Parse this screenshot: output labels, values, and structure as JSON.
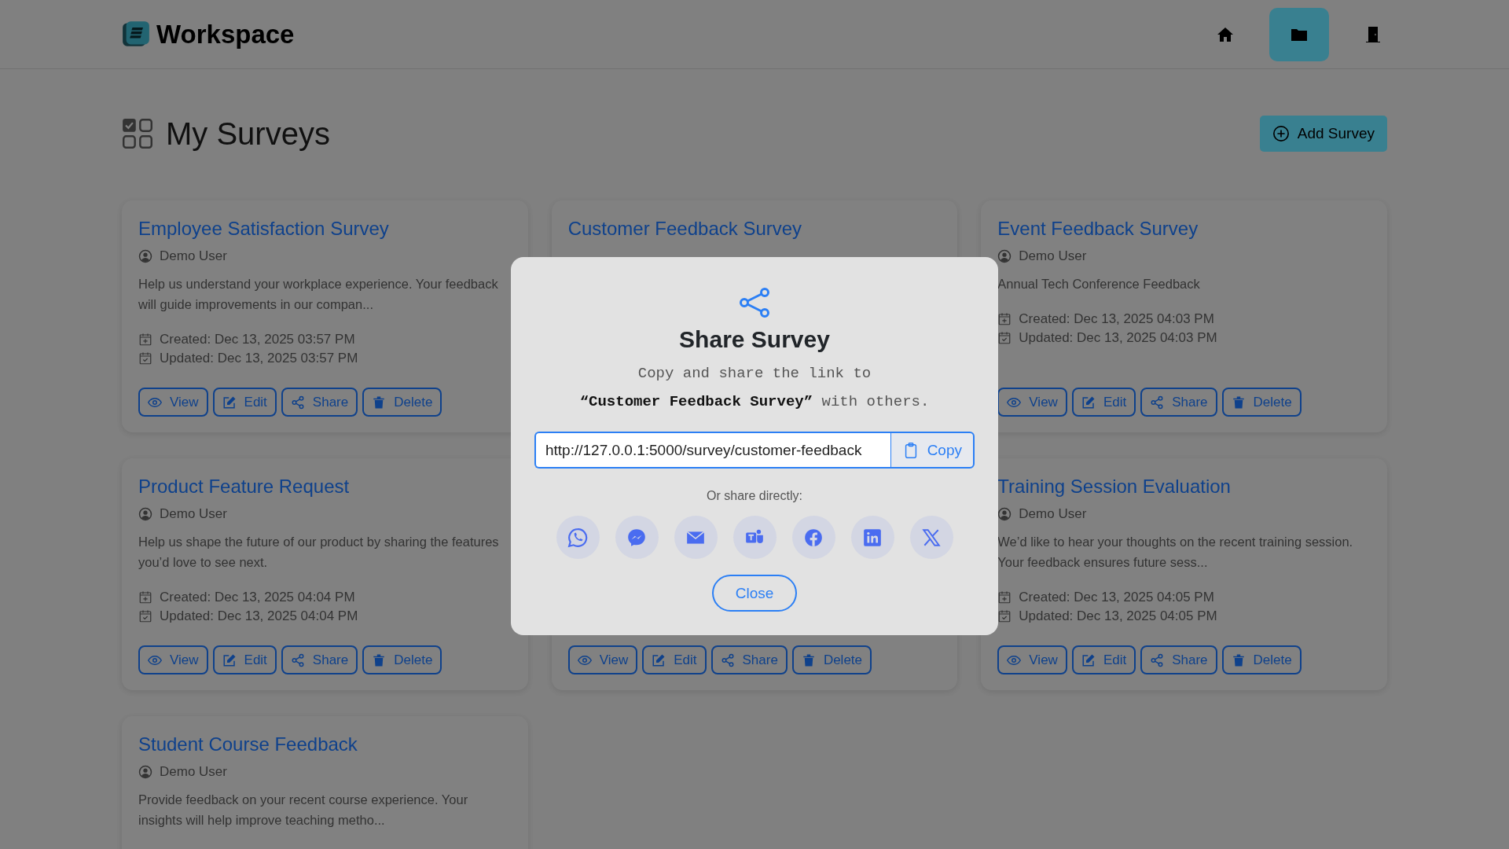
{
  "brand": {
    "name": "Workspace"
  },
  "nav": [
    {
      "kind": "home",
      "selected": false
    },
    {
      "kind": "folder",
      "selected": true
    },
    {
      "kind": "door",
      "selected": false
    }
  ],
  "page": {
    "title": "My Surveys",
    "add_button": "Add Survey"
  },
  "surveys": [
    {
      "title": "Employee Satisfaction Survey",
      "author": "Demo User",
      "description": "Help us understand your workplace experience. Your feedback will guide improvements in our compan...",
      "created": "Created: Dec 13, 2025 03:57 PM",
      "updated": "Updated: Dec 13, 2025 03:57 PM",
      "actions": [
        {
          "kind": "view",
          "label": "View"
        },
        {
          "kind": "edit",
          "label": "Edit"
        },
        {
          "kind": "share",
          "label": "Share"
        },
        {
          "kind": "delete",
          "label": "Delete"
        }
      ]
    },
    {
      "title": "Customer Feedback Survey"
    },
    {
      "title": "Event Feedback Survey",
      "author": "Demo User",
      "description": "Annual Tech Conference Feedback",
      "created": "Created: Dec 13, 2025 04:03 PM",
      "updated": "Updated: Dec 13, 2025 04:03 PM",
      "actions": [
        {
          "kind": "view",
          "label": "View"
        },
        {
          "kind": "edit",
          "label": "Edit"
        },
        {
          "kind": "share",
          "label": "Share"
        },
        {
          "kind": "delete",
          "label": "Delete"
        }
      ]
    },
    {
      "title": "Product Feature Request",
      "author": "Demo User",
      "description": "Help us shape the future of our product by sharing the features you’d love to see next.",
      "created": "Created: Dec 13, 2025 04:04 PM",
      "updated": "Updated: Dec 13, 2025 04:04 PM",
      "actions": [
        {
          "kind": "view",
          "label": "View"
        },
        {
          "kind": "edit",
          "label": "Edit"
        },
        {
          "kind": "share",
          "label": "Share"
        },
        {
          "kind": "delete",
          "label": "Delete"
        }
      ]
    },
    {
      "actions": [
        {
          "kind": "view",
          "label": "View"
        },
        {
          "kind": "edit",
          "label": "Edit"
        },
        {
          "kind": "share",
          "label": "Share"
        },
        {
          "kind": "delete",
          "label": "Delete"
        }
      ]
    },
    {
      "title": "Training Session Evaluation",
      "author": "Demo User",
      "description": "We’d like to hear your thoughts on the recent training session. Your feedback ensures future sess...",
      "created": "Created: Dec 13, 2025 04:05 PM",
      "updated": "Updated: Dec 13, 2025 04:05 PM",
      "actions": [
        {
          "kind": "view",
          "label": "View"
        },
        {
          "kind": "edit",
          "label": "Edit"
        },
        {
          "kind": "share",
          "label": "Share"
        },
        {
          "kind": "delete",
          "label": "Delete"
        }
      ]
    },
    {
      "title": "Student Course Feedback",
      "author": "Demo User",
      "description": "Provide feedback on your recent course experience. Your insights will help improve teaching metho..."
    }
  ],
  "share_modal": {
    "title": "Share Survey",
    "message": "Copy and share the link to\n**“Customer Feedback Survey”** with others.",
    "link": "http://127.0.0.1:5000/survey/customer-feedback",
    "copy_button": "Copy",
    "share_hint": "Or share directly:",
    "share_options": [
      {
        "kind": "whatsapp"
      },
      {
        "kind": "messenger"
      },
      {
        "kind": "email"
      },
      {
        "kind": "teams"
      },
      {
        "kind": "facebook"
      },
      {
        "kind": "linkedin"
      },
      {
        "kind": "x"
      }
    ],
    "close_button": "Close"
  }
}
